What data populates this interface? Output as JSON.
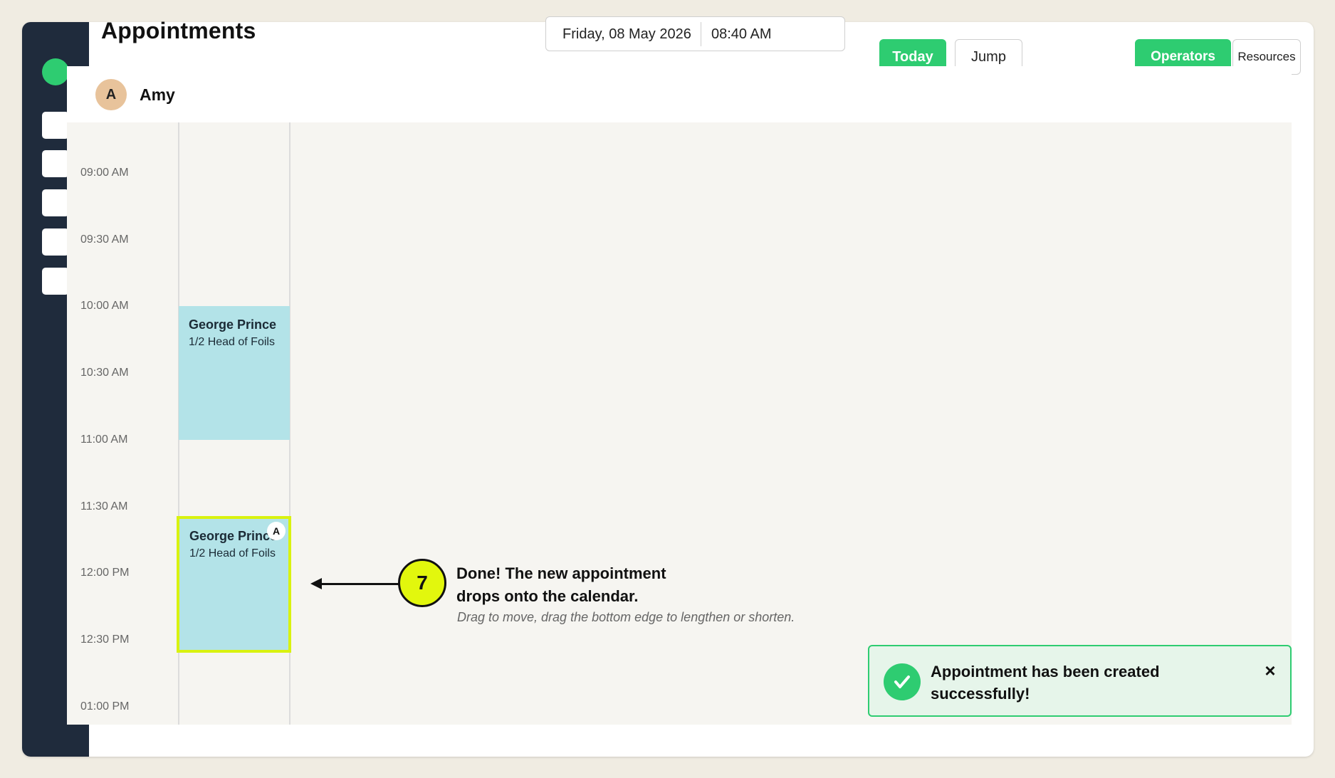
{
  "header": {
    "title": "Appointments",
    "date": "Friday, 08 May 2026",
    "time": "08:40 AM",
    "today_label": "Today",
    "jump_label": "Jump",
    "operators_label": "Operators",
    "resources_label": "Resources"
  },
  "operator": {
    "initial": "A",
    "name": "Amy"
  },
  "times": [
    "09:00 AM",
    "09:30 AM",
    "10:00 AM",
    "10:30 AM",
    "11:00 AM",
    "11:30 AM",
    "12:00 PM",
    "12:30 PM",
    "01:00 PM"
  ],
  "appointments": [
    {
      "client": "George Prince",
      "service": "1/2 Head of Foils"
    },
    {
      "client": "George Prince",
      "service": "1/2 Head of Foils",
      "badge": "A"
    }
  ],
  "callout": {
    "step": "7",
    "title": "Done! The new appointment drops onto the calendar.",
    "subtitle": "Drag to move, drag the bottom edge to lengthen or shorten."
  },
  "toast": {
    "message": "Appointment has been created successfully!",
    "close": "×"
  },
  "colors": {
    "accent": "#2ecc71",
    "sidebar": "#1f2b3c",
    "appointment": "#b3e3e8",
    "highlight": "#e2f70d"
  }
}
